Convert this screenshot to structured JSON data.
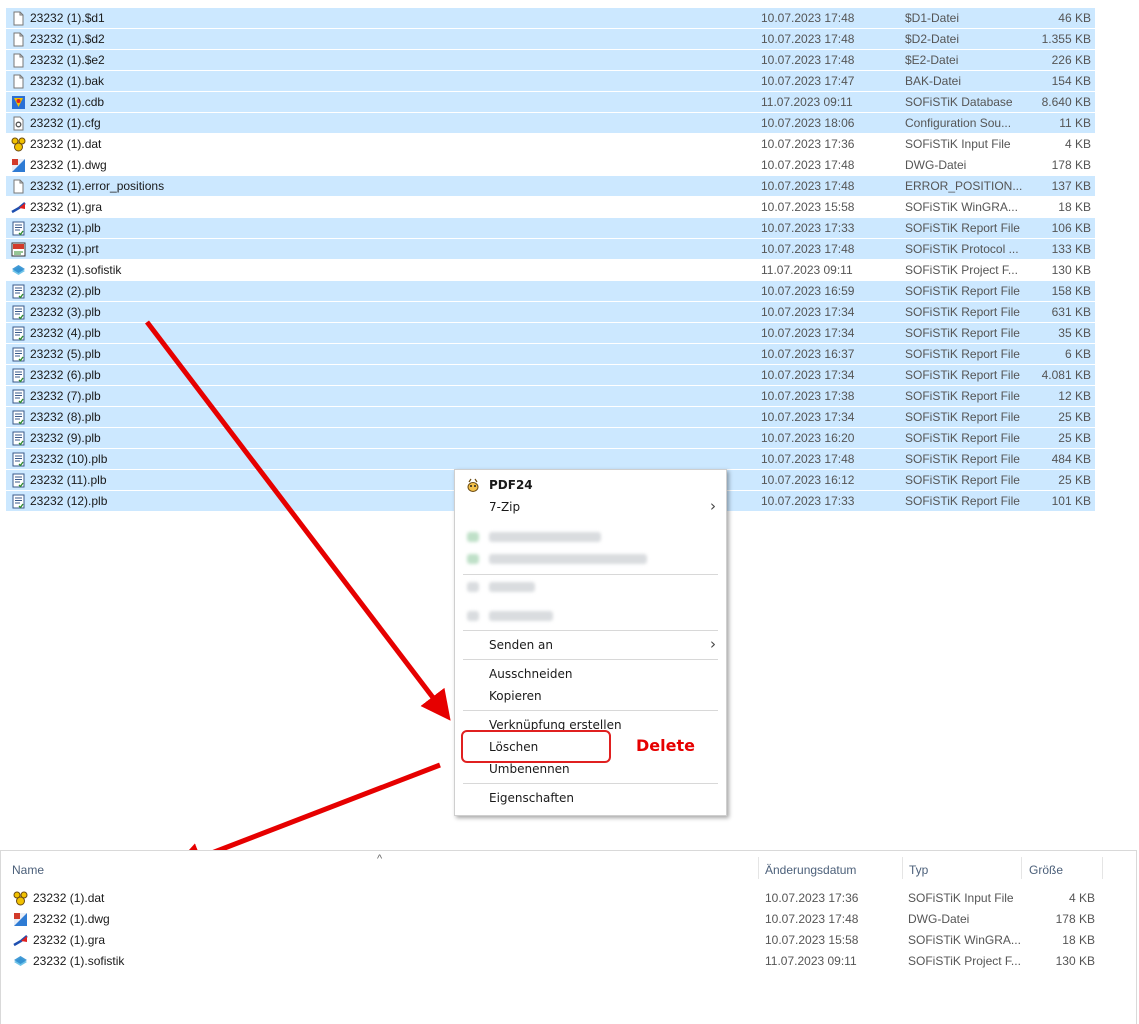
{
  "files": [
    {
      "name": "23232 (1).$d1",
      "date": "10.07.2023 17:48",
      "type": "$D1-Datei",
      "size": "46 KB",
      "icon": "generic-file-icon",
      "selected": true
    },
    {
      "name": "23232 (1).$d2",
      "date": "10.07.2023 17:48",
      "type": "$D2-Datei",
      "size": "1.355 KB",
      "icon": "generic-file-icon",
      "selected": true
    },
    {
      "name": "23232 (1).$e2",
      "date": "10.07.2023 17:48",
      "type": "$E2-Datei",
      "size": "226 KB",
      "icon": "generic-file-icon",
      "selected": true
    },
    {
      "name": "23232 (1).bak",
      "date": "10.07.2023 17:47",
      "type": "BAK-Datei",
      "size": "154 KB",
      "icon": "generic-file-icon",
      "selected": true
    },
    {
      "name": "23232 (1).cdb",
      "date": "11.07.2023 09:11",
      "type": "SOFiSTiK Database",
      "size": "8.640 KB",
      "icon": "sofistik-database-icon",
      "selected": true
    },
    {
      "name": "23232 (1).cfg",
      "date": "10.07.2023 18:06",
      "type": "Configuration Sou...",
      "size": "11 KB",
      "icon": "config-file-icon",
      "selected": true
    },
    {
      "name": "23232 (1).dat",
      "date": "10.07.2023 17:36",
      "type": "SOFiSTiK Input File",
      "size": "4 KB",
      "icon": "sofistik-input-icon",
      "selected": false
    },
    {
      "name": "23232 (1).dwg",
      "date": "10.07.2023 17:48",
      "type": "DWG-Datei",
      "size": "178 KB",
      "icon": "dwg-file-icon",
      "selected": false
    },
    {
      "name": "23232 (1).error_positions",
      "date": "10.07.2023 17:48",
      "type": "ERROR_POSITION...",
      "size": "137 KB",
      "icon": "generic-file-icon",
      "selected": true
    },
    {
      "name": "23232 (1).gra",
      "date": "10.07.2023 15:58",
      "type": "SOFiSTiK WinGRA...",
      "size": "18 KB",
      "icon": "wingraf-icon",
      "selected": false
    },
    {
      "name": "23232 (1).plb",
      "date": "10.07.2023 17:33",
      "type": "SOFiSTiK Report File",
      "size": "106 KB",
      "icon": "report-file-icon",
      "selected": true
    },
    {
      "name": "23232 (1).prt",
      "date": "10.07.2023 17:48",
      "type": "SOFiSTiK Protocol ...",
      "size": "133 KB",
      "icon": "protocol-file-icon",
      "selected": true
    },
    {
      "name": "23232 (1).sofistik",
      "date": "11.07.2023 09:11",
      "type": "SOFiSTiK Project F...",
      "size": "130 KB",
      "icon": "sofistik-project-icon",
      "selected": false
    },
    {
      "name": "23232 (2).plb",
      "date": "10.07.2023 16:59",
      "type": "SOFiSTiK Report File",
      "size": "158 KB",
      "icon": "report-file-icon",
      "selected": true
    },
    {
      "name": "23232 (3).plb",
      "date": "10.07.2023 17:34",
      "type": "SOFiSTiK Report File",
      "size": "631 KB",
      "icon": "report-file-icon",
      "selected": true
    },
    {
      "name": "23232 (4).plb",
      "date": "10.07.2023 17:34",
      "type": "SOFiSTiK Report File",
      "size": "35 KB",
      "icon": "report-file-icon",
      "selected": true
    },
    {
      "name": "23232 (5).plb",
      "date": "10.07.2023 16:37",
      "type": "SOFiSTiK Report File",
      "size": "6 KB",
      "icon": "report-file-icon",
      "selected": true
    },
    {
      "name": "23232 (6).plb",
      "date": "10.07.2023 17:34",
      "type": "SOFiSTiK Report File",
      "size": "4.081 KB",
      "icon": "report-file-icon",
      "selected": true
    },
    {
      "name": "23232 (7).plb",
      "date": "10.07.2023 17:38",
      "type": "SOFiSTiK Report File",
      "size": "12 KB",
      "icon": "report-file-icon",
      "selected": true
    },
    {
      "name": "23232 (8).plb",
      "date": "10.07.2023 17:34",
      "type": "SOFiSTiK Report File",
      "size": "25 KB",
      "icon": "report-file-icon",
      "selected": true
    },
    {
      "name": "23232 (9).plb",
      "date": "10.07.2023 16:20",
      "type": "SOFiSTiK Report File",
      "size": "25 KB",
      "icon": "report-file-icon",
      "selected": true
    },
    {
      "name": "23232 (10).plb",
      "date": "10.07.2023 17:48",
      "type": "SOFiSTiK Report File",
      "size": "484 KB",
      "icon": "report-file-icon",
      "selected": true
    },
    {
      "name": "23232 (11).plb",
      "date": "10.07.2023 16:12",
      "type": "SOFiSTiK Report File",
      "size": "25 KB",
      "icon": "report-file-icon",
      "selected": true
    },
    {
      "name": "23232 (12).plb",
      "date": "10.07.2023 17:33",
      "type": "SOFiSTiK Report File",
      "size": "101 KB",
      "icon": "report-file-icon",
      "selected": true
    }
  ],
  "context_menu": {
    "pdf24": "PDF24",
    "zip": "7-Zip",
    "send_to": "Senden an",
    "cut": "Ausschneiden",
    "copy": "Kopieren",
    "shortcut": "Verknüpfung erstellen",
    "delete": "Löschen",
    "rename": "Umbenennen",
    "properties": "Eigenschaften"
  },
  "annotation": {
    "label": "Delete",
    "color": "#e60000"
  },
  "result_view": {
    "columns": {
      "name": "Name",
      "date": "Änderungsdatum",
      "type": "Typ",
      "size": "Größe"
    },
    "files": [
      {
        "name": "23232 (1).dat",
        "date": "10.07.2023 17:36",
        "type": "SOFiSTiK Input File",
        "size": "4 KB",
        "icon": "sofistik-input-icon"
      },
      {
        "name": "23232 (1).dwg",
        "date": "10.07.2023 17:48",
        "type": "DWG-Datei",
        "size": "178 KB",
        "icon": "dwg-file-icon"
      },
      {
        "name": "23232 (1).gra",
        "date": "10.07.2023 15:58",
        "type": "SOFiSTiK WinGRA...",
        "size": "18 KB",
        "icon": "wingraf-icon"
      },
      {
        "name": "23232 (1).sofistik",
        "date": "11.07.2023 09:11",
        "type": "SOFiSTiK Project F...",
        "size": "130 KB",
        "icon": "sofistik-project-icon"
      }
    ]
  },
  "colors": {
    "selection": "#cce8ff",
    "accent_red": "#e60000"
  }
}
